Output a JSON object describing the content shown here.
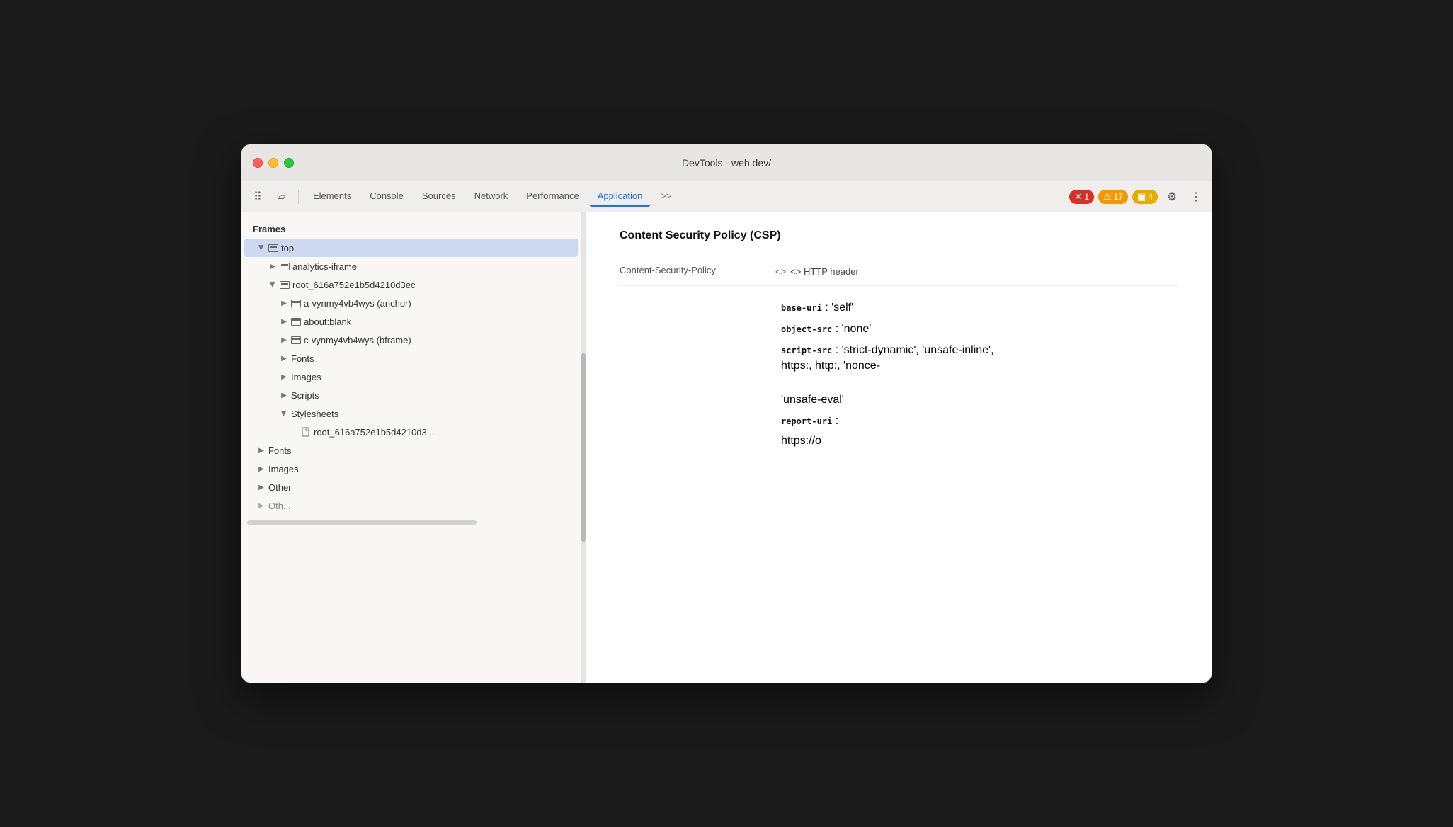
{
  "window": {
    "title": "DevTools - web.dev/"
  },
  "toolbar": {
    "tabs": [
      {
        "id": "elements",
        "label": "Elements",
        "active": false
      },
      {
        "id": "console",
        "label": "Console",
        "active": false
      },
      {
        "id": "sources",
        "label": "Sources",
        "active": false
      },
      {
        "id": "network",
        "label": "Network",
        "active": false
      },
      {
        "id": "performance",
        "label": "Performance",
        "active": false
      },
      {
        "id": "application",
        "label": "Application",
        "active": true
      }
    ],
    "more_tabs_label": ">>",
    "error_count": "1",
    "warning_count": "17",
    "info_count": "4"
  },
  "sidebar": {
    "header": "Frames",
    "items": [
      {
        "id": "top",
        "label": "top",
        "indent": 1,
        "type": "folder",
        "expanded": true,
        "selected": true
      },
      {
        "id": "analytics-iframe",
        "label": "analytics-iframe",
        "indent": 2,
        "type": "folder",
        "expanded": false
      },
      {
        "id": "root-frame",
        "label": "root_616a752e1b5d4210d3ec",
        "indent": 2,
        "type": "folder",
        "expanded": true
      },
      {
        "id": "a-vynmy",
        "label": "a-vynmy4vb4wys (anchor)",
        "indent": 3,
        "type": "folder",
        "expanded": false
      },
      {
        "id": "about-blank",
        "label": "about:blank",
        "indent": 3,
        "type": "folder",
        "expanded": false
      },
      {
        "id": "c-vynmy",
        "label": "c-vynmy4vb4wys (bframe)",
        "indent": 3,
        "type": "folder",
        "expanded": false
      },
      {
        "id": "fonts-inner",
        "label": "Fonts",
        "indent": 3,
        "type": "leaf-folder",
        "expanded": false
      },
      {
        "id": "images-inner",
        "label": "Images",
        "indent": 3,
        "type": "leaf-folder",
        "expanded": false
      },
      {
        "id": "scripts-inner",
        "label": "Scripts",
        "indent": 3,
        "type": "leaf-folder",
        "expanded": false
      },
      {
        "id": "stylesheets-inner",
        "label": "Stylesheets",
        "indent": 3,
        "type": "leaf-folder",
        "expanded": true
      },
      {
        "id": "root-file",
        "label": "root_616a752e1b5d4210d3...",
        "indent": 4,
        "type": "file"
      },
      {
        "id": "fonts-outer",
        "label": "Fonts",
        "indent": 1,
        "type": "leaf-folder",
        "expanded": false
      },
      {
        "id": "images-outer",
        "label": "Images",
        "indent": 1,
        "type": "leaf-folder",
        "expanded": false
      },
      {
        "id": "other-outer",
        "label": "Other",
        "indent": 1,
        "type": "leaf-folder",
        "expanded": false
      },
      {
        "id": "other2-outer",
        "label": "Oth...",
        "indent": 1,
        "type": "leaf-folder",
        "expanded": false
      }
    ]
  },
  "content": {
    "title": "Content Security Policy (CSP)",
    "key_label": "Content-Security-Policy",
    "value_type": "<> HTTP header",
    "directives": [
      {
        "prop": "base-uri",
        "value": "'self'"
      },
      {
        "prop": "object-src",
        "value": "'none'"
      },
      {
        "prop": "script-src",
        "value": "'strict-dynamic', 'unsafe-inline',"
      },
      {
        "prop_cont": "https:, http:, 'nonce-"
      }
    ],
    "unsafe_eval": "'unsafe-eval'",
    "report_uri_label": "report-uri",
    "report_uri_value": "https://o"
  },
  "icons": {
    "selector": "⠿",
    "device": "⬜",
    "arrow_right": "▶",
    "arrow_down": "▼",
    "close_x": "✕",
    "warning_triangle": "⚠",
    "info_square": "▣",
    "gear": "⚙",
    "more": "⋮",
    "folder": "📁",
    "file": "📄",
    "code_brackets": "<>"
  }
}
